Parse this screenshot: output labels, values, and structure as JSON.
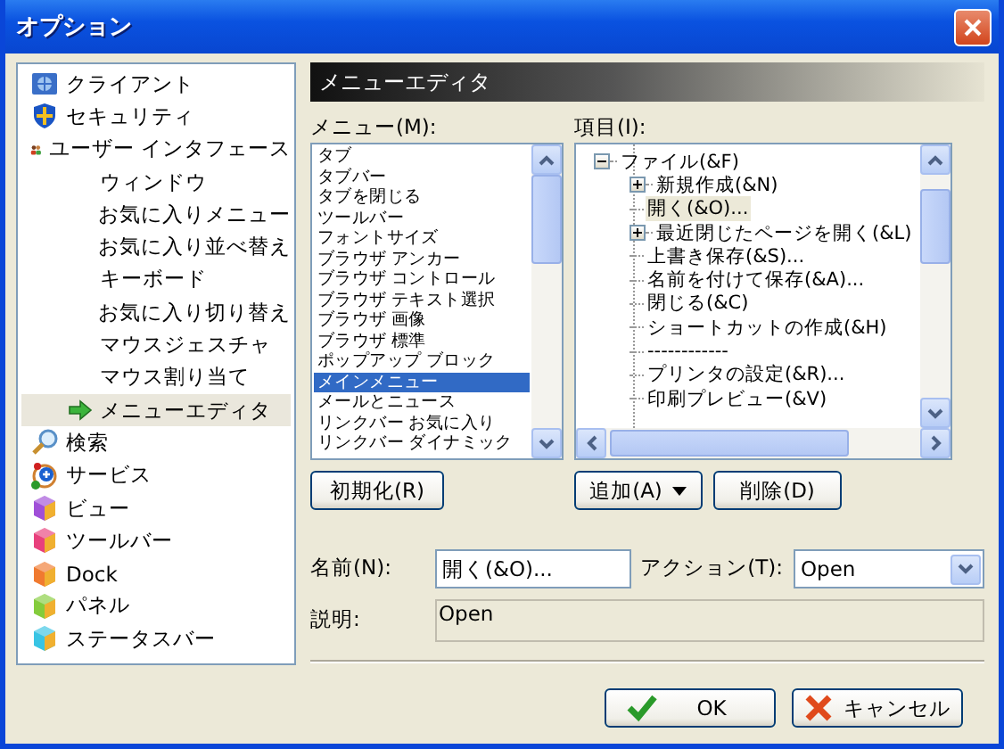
{
  "window": {
    "title": "オプション"
  },
  "nav": [
    {
      "label": "クライアント",
      "kind": "globe",
      "selected": false
    },
    {
      "label": "セキュリティ",
      "kind": "shield",
      "selected": false
    },
    {
      "label": "ユーザー インタフェース",
      "kind": "people",
      "selected": false,
      "children": [
        {
          "label": "ウィンドウ",
          "selected": false
        },
        {
          "label": "お気に入りメニュー",
          "selected": false
        },
        {
          "label": "お気に入り並べ替え",
          "selected": false
        },
        {
          "label": "キーボード",
          "selected": false
        },
        {
          "label": "お気に入り切り替え",
          "selected": false
        },
        {
          "label": "マウスジェスチャ",
          "selected": false
        },
        {
          "label": "マウス割り当て",
          "selected": false
        },
        {
          "label": "メニューエディタ",
          "selected": true
        }
      ]
    },
    {
      "label": "検索",
      "kind": "magnifier",
      "selected": false
    },
    {
      "label": "サービス",
      "kind": "service",
      "selected": false
    },
    {
      "label": "ビュー",
      "kind": "cube",
      "color": "#a04fd8",
      "selected": false
    },
    {
      "label": "ツールバー",
      "kind": "cube",
      "color": "#e8407c",
      "selected": false
    },
    {
      "label": "Dock",
      "kind": "cube",
      "color": "#f07a30",
      "selected": false
    },
    {
      "label": "パネル",
      "kind": "cube",
      "color": "#84cc3c",
      "selected": false
    },
    {
      "label": "ステータスバー",
      "kind": "cube",
      "color": "#38c4e4",
      "selected": false
    }
  ],
  "section_title": "メニューエディタ",
  "menu_list": {
    "label": "メニュー(M):",
    "items": [
      {
        "label": "タブ",
        "selected": false
      },
      {
        "label": "タブバー",
        "selected": false
      },
      {
        "label": "タブを閉じる",
        "selected": false
      },
      {
        "label": "ツールバー",
        "selected": false
      },
      {
        "label": "フォントサイズ",
        "selected": false
      },
      {
        "label": "ブラウザ アンカー",
        "selected": false
      },
      {
        "label": "ブラウザ コントロール",
        "selected": false
      },
      {
        "label": "ブラウザ テキスト選択",
        "selected": false
      },
      {
        "label": "ブラウザ 画像",
        "selected": false
      },
      {
        "label": "ブラウザ 標準",
        "selected": false
      },
      {
        "label": "ポップアップ ブロック",
        "selected": false
      },
      {
        "label": "メインメニュー",
        "selected": true
      },
      {
        "label": "メールとニュース",
        "selected": false
      },
      {
        "label": "リンクバー お気に入り",
        "selected": false
      },
      {
        "label": "リンクバー ダイナミック",
        "selected": false
      }
    ]
  },
  "items_tree": {
    "label": "項目(I):",
    "nodes": [
      {
        "label": "ファイル(&F)",
        "expanded": true,
        "selected": false,
        "children": [
          {
            "label": "新規作成(&N)",
            "expanded": false,
            "selected": false
          },
          {
            "label": "開く(&O)...",
            "selected": true
          },
          {
            "label": "最近閉じたページを開く(&L)",
            "expanded": false,
            "selected": false
          },
          {
            "label": "上書き保存(&S)...",
            "selected": false
          },
          {
            "label": "名前を付けて保存(&A)...",
            "selected": false
          },
          {
            "label": "閉じる(&C)",
            "selected": false
          },
          {
            "label": "ショートカットの作成(&H)",
            "selected": false
          },
          {
            "label": "------------",
            "selected": false
          },
          {
            "label": "プリンタの設定(&R)...",
            "selected": false
          },
          {
            "label": "印刷プレビュー(&V)",
            "selected": false
          }
        ]
      }
    ]
  },
  "reset_button": "初期化(R)",
  "add_button": "追加(A)",
  "delete_button": "削除(D)",
  "name_field": {
    "label": "名前(N):",
    "value": "開く(&O)..."
  },
  "action_field": {
    "label": "アクション(T):",
    "value": "Open"
  },
  "description_field": {
    "label": "説明:",
    "value": "Open"
  },
  "ok_button": "OK",
  "cancel_button": "キャンセル"
}
